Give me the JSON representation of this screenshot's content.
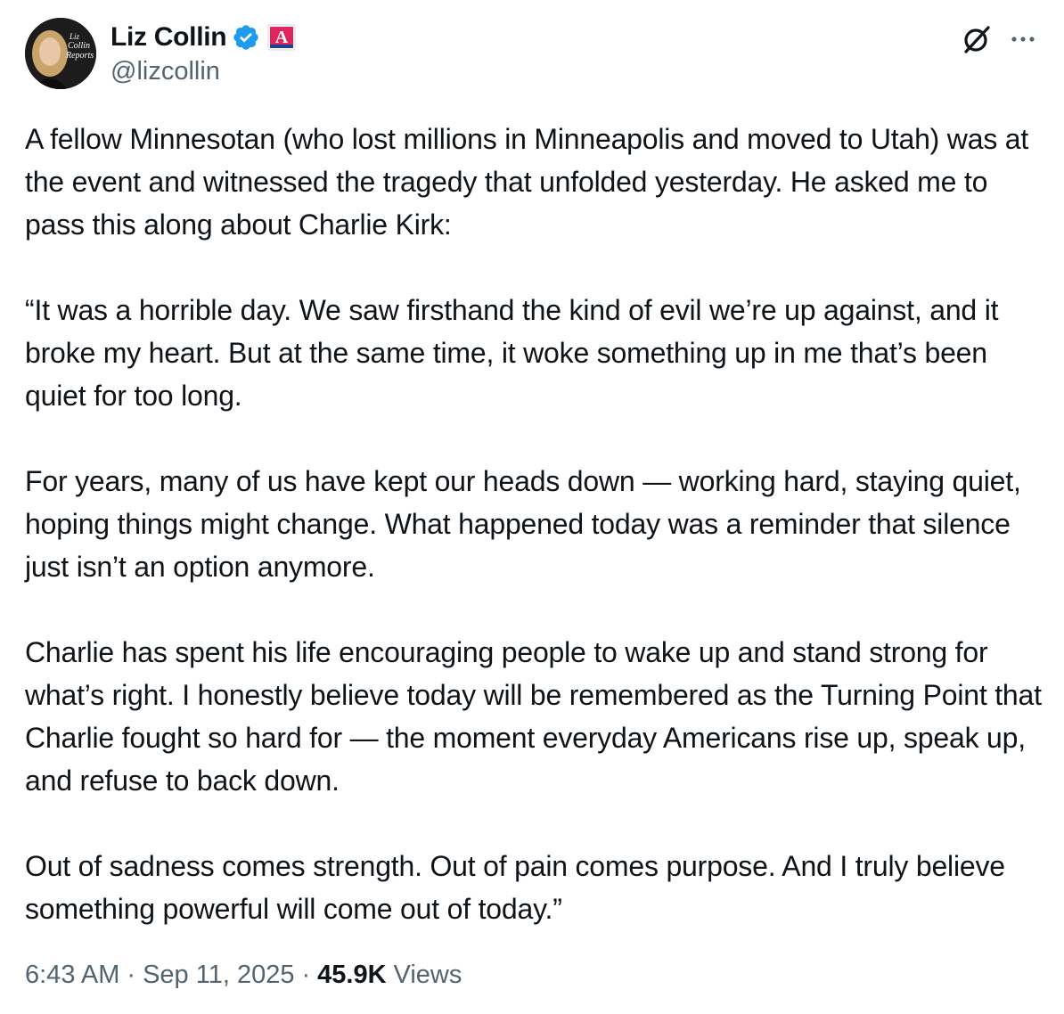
{
  "author": {
    "display_name": "Liz Collin",
    "handle": "@lizcollin",
    "avatar_text": "Liz Collin Reports",
    "verified_color": "#1d9bf0",
    "affiliate_color": "#e0245e"
  },
  "icons": {
    "verified": "verified-badge-icon",
    "affiliate": "affiliate-badge-icon",
    "grok": "grok-icon",
    "more": "more-icon"
  },
  "tweet": {
    "text": "A fellow Minnesotan (who lost millions in Minneapolis and moved to Utah) was at the event and witnessed the tragedy that unfolded yesterday. He asked me to pass this along about Charlie Kirk:\n\n“It was a horrible day. We saw firsthand the kind of evil we’re up against, and it broke my heart. But at the same time, it woke something up in me that’s been quiet for too long.\n\nFor years, many of us have kept our heads down — working hard, staying quiet, hoping things might change. What happened today was a reminder that silence just isn’t an option anymore.\n\nCharlie has spent his life encouraging people to wake up and stand strong for what’s right. I honestly believe today will be remembered as the Turning Point that Charlie fought so hard for — the moment everyday Americans rise up, speak up, and refuse to back down.\n\nOut of sadness comes strength. Out of pain comes purpose. And I truly believe something powerful will come out of today.”"
  },
  "meta": {
    "time": "6:43 AM",
    "separator": "·",
    "date": "Sep 11, 2025",
    "views_count": "45.9K",
    "views_label": "Views"
  }
}
